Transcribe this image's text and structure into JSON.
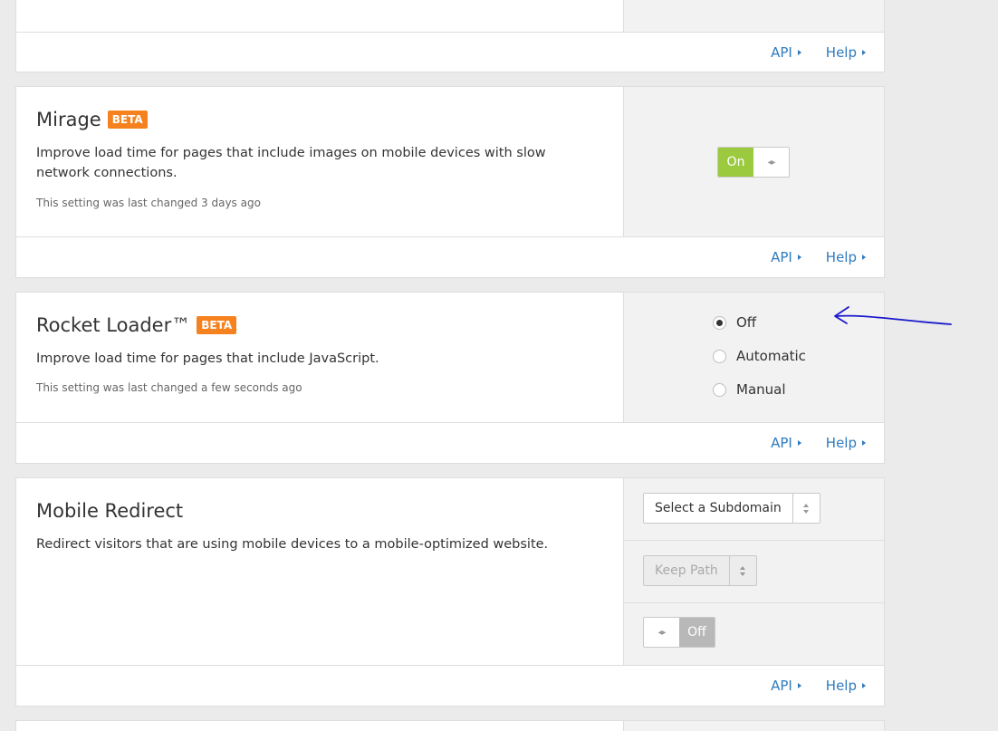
{
  "top_card": {
    "api_label": "API",
    "help_label": "Help"
  },
  "mirage": {
    "title": "Mirage",
    "badge": "BETA",
    "description": "Improve load time for pages that include images on mobile devices with slow network connections.",
    "changed": "This setting was last changed 3 days ago",
    "toggle_label": "On",
    "toggle_state": "on",
    "api_label": "API",
    "help_label": "Help"
  },
  "rocket": {
    "title": "Rocket Loader™",
    "badge": "BETA",
    "description": "Improve load time for pages that include JavaScript.",
    "changed": "This setting was last changed a few seconds ago",
    "options": [
      "Off",
      "Automatic",
      "Manual"
    ],
    "selected": "Off",
    "api_label": "API",
    "help_label": "Help"
  },
  "mobile": {
    "title": "Mobile Redirect",
    "description": "Redirect visitors that are using mobile devices to a mobile-optimized website.",
    "subdomain_select": "Select a Subdomain",
    "path_select": "Keep Path",
    "toggle_label": "Off",
    "toggle_state": "off",
    "api_label": "API",
    "help_label": "Help"
  },
  "colors": {
    "beta": "#f6821f",
    "toggle_on": "#9bca3e",
    "link": "#2f7bbf",
    "annotation": "#1a1acc"
  },
  "annotation": {
    "icon": "hand-drawn-arrow-icon"
  }
}
